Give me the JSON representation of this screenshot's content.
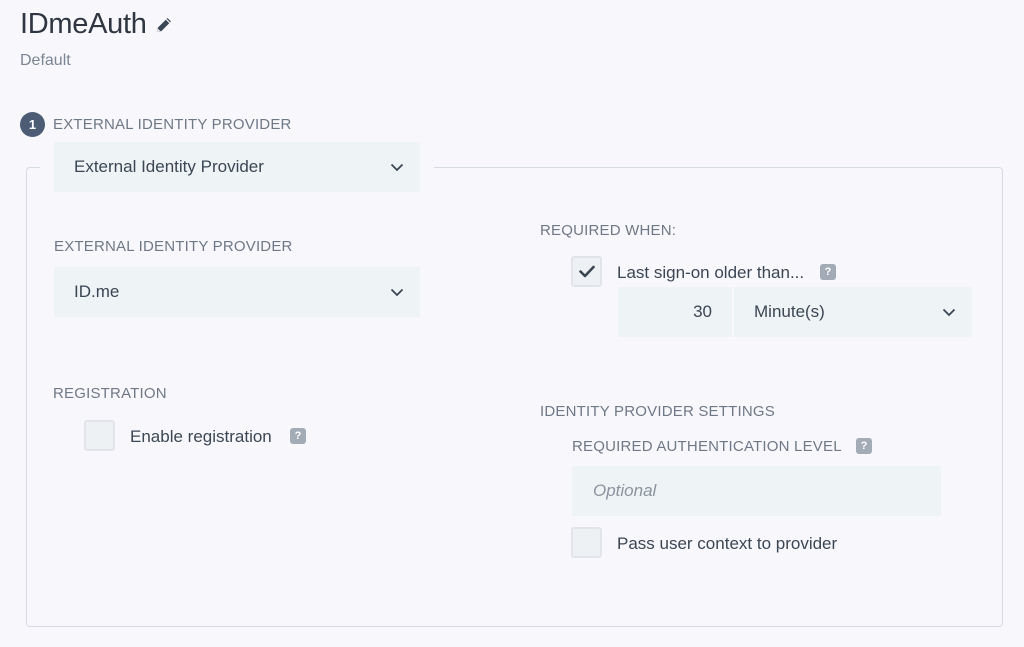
{
  "header": {
    "title": "IDmeAuth",
    "subtitle": "Default"
  },
  "step": {
    "number": "1",
    "label": "EXTERNAL IDENTITY PROVIDER"
  },
  "type_select": {
    "value": "External Identity Provider"
  },
  "provider": {
    "label": "EXTERNAL IDENTITY PROVIDER",
    "value": "ID.me"
  },
  "required_when": {
    "label": "REQUIRED WHEN:",
    "checkbox_label": "Last sign-on older than...",
    "checked": true,
    "amount": "30",
    "unit": "Minute(s)"
  },
  "registration": {
    "label": "REGISTRATION",
    "checkbox_label": "Enable registration",
    "checked": false
  },
  "idp_settings": {
    "label": "IDENTITY PROVIDER SETTINGS",
    "auth_level_label": "REQUIRED AUTHENTICATION LEVEL",
    "auth_level_placeholder": "Optional",
    "pass_context_label": "Pass user context to provider",
    "pass_context_checked": false
  },
  "icons": {
    "help": "?"
  },
  "colors": {
    "background": "#f8f8fc",
    "field": "#eef3f5",
    "step_badge": "#4b5c74",
    "text": "#3b4654",
    "muted": "#6f7886"
  }
}
